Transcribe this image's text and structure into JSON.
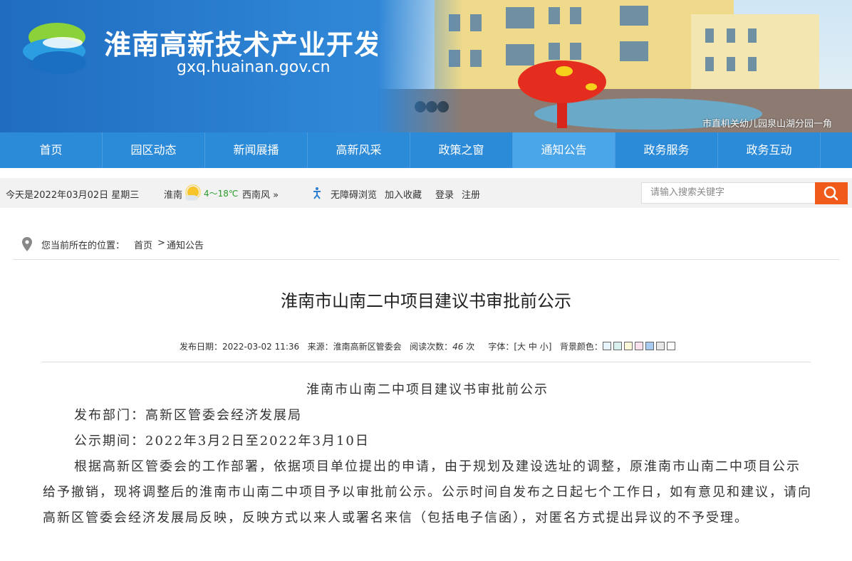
{
  "header": {
    "title": "淮南高新技术产业开发区",
    "url": "gxq.huainan.gov.cn",
    "banner_caption": "市直机关幼儿园泉山湖分园一角"
  },
  "nav": {
    "items": [
      "首页",
      "园区动态",
      "新闻展播",
      "高新风采",
      "政策之窗",
      "通知公告",
      "政务服务",
      "政务互动"
    ],
    "active": "通知公告"
  },
  "infobar": {
    "date": "今天是2022年03月02日 星期三",
    "city": "淮南",
    "temp": "4～18℃",
    "wind": "西南风 »",
    "accessible": "无障碍浏览",
    "favorite": "加入收藏",
    "login": "登录",
    "register": "注册",
    "search_placeholder": "请输入搜索关键字"
  },
  "breadcrumb": {
    "prefix": "您当前所在的位置：",
    "home": "首页",
    "sep": ">",
    "current": "通知公告"
  },
  "article": {
    "title": "淮南市山南二中项目建议书审批前公示",
    "meta": {
      "date_label": "发布日期：",
      "date": "2022-03-02 11:36",
      "source_label": "来源：",
      "source": "淮南高新区管委会",
      "views_label": "阅读次数：",
      "views": "46",
      "views_unit": "次",
      "font_label": "字体：[",
      "font_sizes": [
        "大",
        "中",
        "小"
      ],
      "font_end": "]",
      "bg_label": "背景颜色：",
      "bg_colors": [
        "#e8f4fb",
        "#d8f0ee",
        "#fdf8d8",
        "#fbe0ee",
        "#a6cbee",
        "#e8e8e8",
        "#ffffff"
      ]
    },
    "sub_title": "淮南市山南二中项目建议书审批前公示",
    "department": "发布部门：高新区管委会经济发展局",
    "period": "公示期间：2022年3月2日至2022年3月10日",
    "paragraph": "根据高新区管委会的工作部署，依据项目单位提出的申请，由于规划及建设选址的调整，原淮南市山南二中项目公示给予撤销，现将调整后的淮南市山南二中项目予以审批前公示。公示时间自发布之日起七个工作日，如有意见和建议，请向高新区管委会经济发展局反映，反映方式以来人或署名来信（包括电子信函），对匿名方式提出异议的不予受理。"
  }
}
